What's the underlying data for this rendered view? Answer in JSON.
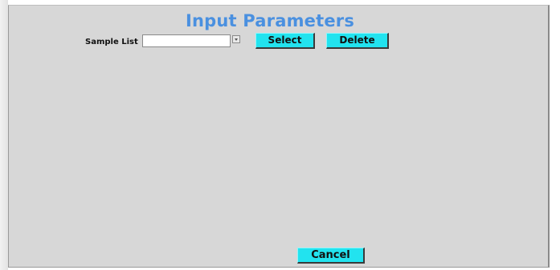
{
  "dialog": {
    "title": "Input Parameters",
    "sample_list_label": "Sample List",
    "sample_list_value": "",
    "select_label": "Select",
    "delete_label": "Delete",
    "cancel_label": "Cancel"
  },
  "colors": {
    "title": "#4a90e0",
    "button": "#22e3ef",
    "background": "#d7d7d7"
  },
  "icons": {
    "dropdown": "chevron-down-icon"
  }
}
